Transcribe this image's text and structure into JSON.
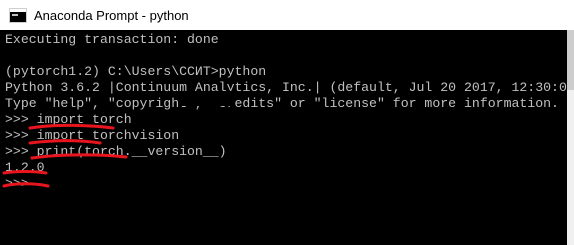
{
  "window": {
    "title": "Anaconda Prompt - python",
    "icon": "console-icon"
  },
  "console": {
    "lines": [
      "Executing transaction: done",
      "",
      "(pytorch1.2) C:\\Users\\CСИТ>python",
      "Python 3.6.2 |Continuum Analytics, Inc.| (default, Jul 20 2017, 12:30:0",
      "Type \"help\", \"copyright\", \"credits\" or \"license\" for more information.",
      ">>> import torch",
      ">>> import torchvision",
      ">>> print(torch.__version__)",
      "1.2.0",
      ">>> "
    ]
  },
  "colors": {
    "console_bg": "#000000",
    "console_text": "#c0c0c0",
    "annotation": "#e8141e",
    "titlebar_bg": "#ffffff"
  }
}
